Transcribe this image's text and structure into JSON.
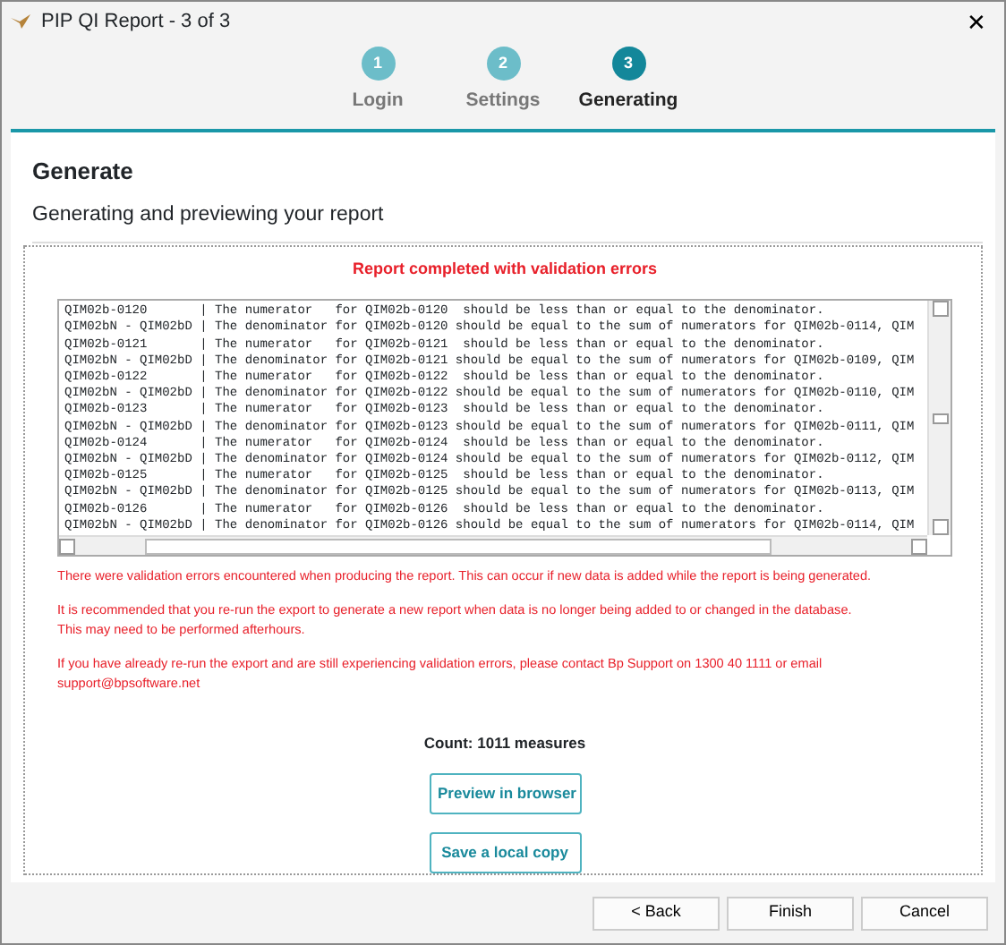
{
  "window": {
    "title": "PIP QI Report - 3 of 3",
    "close": "✕"
  },
  "steps": [
    {
      "number": "1",
      "label": "Login",
      "selected": false
    },
    {
      "number": "2",
      "label": "Settings",
      "selected": false
    },
    {
      "number": "3",
      "label": "Generating",
      "selected": true
    }
  ],
  "page": {
    "title": "Generate",
    "subtitle": "Generating and previewing your report"
  },
  "status": "Report completed with validation errors",
  "log_lines": [
    "QIM02b-0120       | The numerator   for QIM02b-0120  should be less than or equal to the denominator.",
    "QIM02bN - QIM02bD | The denominator for QIM02b-0120 should be equal to the sum of numerators for QIM02b-0114, QIM",
    "QIM02b-0121       | The numerator   for QIM02b-0121  should be less than or equal to the denominator.",
    "QIM02bN - QIM02bD | The denominator for QIM02b-0121 should be equal to the sum of numerators for QIM02b-0109, QIM",
    "QIM02b-0122       | The numerator   for QIM02b-0122  should be less than or equal to the denominator.",
    "QIM02bN - QIM02bD | The denominator for QIM02b-0122 should be equal to the sum of numerators for QIM02b-0110, QIM",
    "QIM02b-0123       | The numerator   for QIM02b-0123  should be less than or equal to the denominator.",
    "QIM02bN - QIM02bD | The denominator for QIM02b-0123 should be equal to the sum of numerators for QIM02b-0111, QIM",
    "QIM02b-0124       | The numerator   for QIM02b-0124  should be less than or equal to the denominator.",
    "QIM02bN - QIM02bD | The denominator for QIM02b-0124 should be equal to the sum of numerators for QIM02b-0112, QIM",
    "QIM02b-0125       | The numerator   for QIM02b-0125  should be less than or equal to the denominator.",
    "QIM02bN - QIM02bD | The denominator for QIM02b-0125 should be equal to the sum of numerators for QIM02b-0113, QIM",
    "QIM02b-0126       | The numerator   for QIM02b-0126  should be less than or equal to the denominator.",
    "QIM02bN - QIM02bD | The denominator for QIM02b-0126 should be equal to the sum of numerators for QIM02b-0114, QIM"
  ],
  "messages": [
    {
      "lines": [
        "There were validation errors encountered when producing the report. This can occur if new data is added while the report is being generated."
      ]
    },
    {
      "lines": [
        "It is recommended that you re-run the export to generate a new report when data is no longer being added to or changed in the database.",
        "This may need to be performed afterhours."
      ]
    },
    {
      "lines": [
        "If you have already re-run the export and are still experiencing validation errors, please contact Bp Support on 1300 40 1111 or email",
        "support@bpsoftware.net"
      ]
    }
  ],
  "count": "Count: 1011 measures",
  "actions": [
    "Preview in browser",
    "Save a local copy"
  ],
  "footer_buttons": [
    "< Back",
    "Finish",
    "Cancel"
  ]
}
